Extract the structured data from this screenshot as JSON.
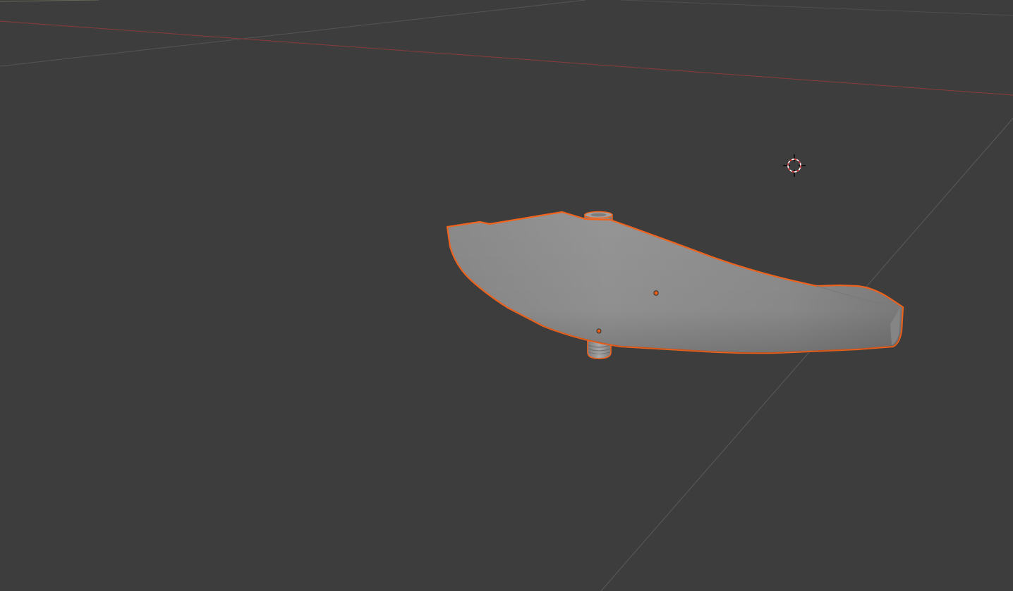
{
  "viewport": {
    "background": "#3d3d3d",
    "grid_color": "#555555",
    "x_axis_color": "#8a3b3b"
  },
  "selection": {
    "outline_color": "#f0641e",
    "origin_color": "#e8601c"
  },
  "object": {
    "surface_color": "#909090",
    "shadow_color": "#6f6f6f"
  },
  "icons": {
    "cursor3d": "3d-cursor-icon"
  }
}
